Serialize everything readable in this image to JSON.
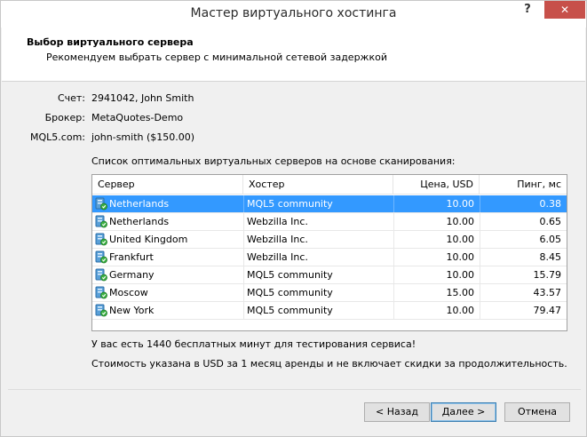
{
  "window": {
    "title": "Мастер виртуального хостинга",
    "help_label": "?",
    "close_label": "✕"
  },
  "header": {
    "title": "Выбор виртуального сервера",
    "subtitle": "Рекомендуем выбрать сервер с минимальной сетевой задержкой"
  },
  "account": {
    "account_label": "Счет:",
    "account_value": "2941042, John Smith",
    "broker_label": "Брокер:",
    "broker_value": "MetaQuotes-Demo",
    "mql5_label": "MQL5.com:",
    "mql5_value": "john-smith ($150.00)"
  },
  "list_caption": "Список оптимальных виртуальных серверов на основе сканирования:",
  "table": {
    "columns": [
      "Сервер",
      "Хостер",
      "Цена, USD",
      "Пинг, мс"
    ],
    "rows": [
      {
        "server": "Netherlands",
        "hoster": "MQL5 community",
        "price": "10.00",
        "ping": "0.38"
      },
      {
        "server": "Netherlands",
        "hoster": "Webzilla Inc.",
        "price": "10.00",
        "ping": "0.65"
      },
      {
        "server": "United Kingdom",
        "hoster": "Webzilla Inc.",
        "price": "10.00",
        "ping": "6.05"
      },
      {
        "server": "Frankfurt",
        "hoster": "Webzilla Inc.",
        "price": "10.00",
        "ping": "8.45"
      },
      {
        "server": "Germany",
        "hoster": "MQL5 community",
        "price": "10.00",
        "ping": "15.79"
      },
      {
        "server": "Moscow",
        "hoster": "MQL5 community",
        "price": "15.00",
        "ping": "43.57"
      },
      {
        "server": "New York",
        "hoster": "MQL5 community",
        "price": "10.00",
        "ping": "79.47"
      }
    ],
    "selected_index": 0,
    "row_icon": "server-icon"
  },
  "notes": {
    "free_minutes": "У вас есть 1440 бесплатных минут для тестирования сервиса!",
    "price_note": "Стоимость указана в USD за 1 месяц аренды и не включает скидки за продолжительность."
  },
  "buttons": {
    "back": "< Назад",
    "next": "Далее >",
    "cancel": "Отмена"
  },
  "colors": {
    "selection": "#3399ff",
    "close_button": "#c7504a"
  }
}
